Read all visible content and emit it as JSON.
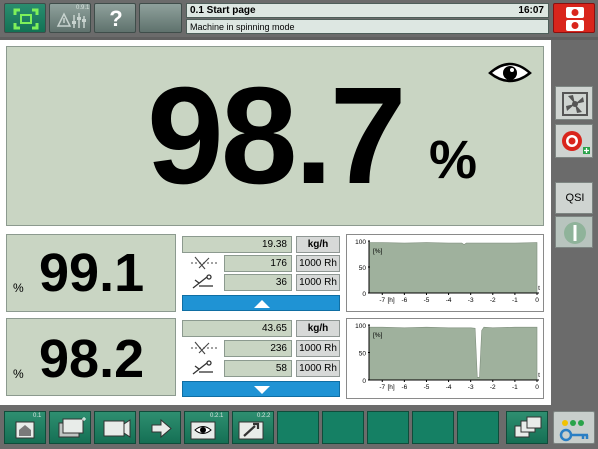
{
  "header": {
    "page_title": "0.1 Start page",
    "time": "16:07",
    "status_message": "Machine in spinning mode",
    "button_badges": {
      "signal": "0.9.1"
    }
  },
  "main": {
    "big_value": "98.7",
    "big_unit": "%"
  },
  "side": {
    "qsi_label": "QSI"
  },
  "rows": [
    {
      "percent_value": "99.1",
      "percent_unit": "%",
      "rate_value": "19.38",
      "rate_unit": "kg/h",
      "cut_count": "176",
      "cut_unit": "1000 Rh",
      "splice_count": "36",
      "splice_unit": "1000 Rh",
      "arrow": "up"
    },
    {
      "percent_value": "98.2",
      "percent_unit": "%",
      "rate_value": "43.65",
      "rate_unit": "kg/h",
      "cut_count": "236",
      "cut_unit": "1000 Rh",
      "splice_count": "58",
      "splice_unit": "1000 Rh",
      "arrow": "down"
    }
  ],
  "chart_data": [
    {
      "type": "area",
      "ylabel": "[%]",
      "xlabel": "[h]",
      "x_axis_letter": "t",
      "y_ticks": [
        "100",
        "50",
        "0"
      ],
      "x_ticks": [
        "-7",
        "-6",
        "-5",
        "-4",
        "-3",
        "-2",
        "-1",
        "0"
      ],
      "ylim": [
        0,
        100
      ],
      "xlim": [
        -7.6,
        0
      ],
      "x": [
        -7.6,
        -7,
        -6,
        -5,
        -4,
        -3.4,
        -3.3,
        -3.2,
        -3,
        -2.5,
        -2,
        -1,
        0
      ],
      "values": [
        97,
        97,
        96,
        97,
        96,
        96,
        93,
        96,
        96,
        96,
        96,
        96,
        97
      ]
    },
    {
      "type": "area",
      "ylabel": "[%]",
      "xlabel": "[h]",
      "x_axis_letter": "t",
      "y_ticks": [
        "100",
        "50",
        "0"
      ],
      "x_ticks": [
        "-7",
        "-6",
        "-5",
        "-4",
        "-3",
        "-2",
        "-1",
        "0"
      ],
      "ylim": [
        0,
        100
      ],
      "xlim": [
        -7.6,
        0
      ],
      "x": [
        -7.6,
        -7,
        -6,
        -5,
        -4,
        -3,
        -2.8,
        -2.7,
        -2.6,
        -2.5,
        -2.4,
        -2,
        -1,
        0
      ],
      "values": [
        96,
        96,
        95,
        96,
        95,
        95,
        94,
        5,
        5,
        90,
        96,
        95,
        96,
        96
      ]
    }
  ],
  "bottom_bar": {
    "badges": {
      "home": "0.1",
      "monitor": "0.2.1",
      "settings": "0.2.2"
    }
  },
  "colors": {
    "panel_bg": "#c9d5c3",
    "accent_blue": "#1f93d4",
    "stop_red": "#d9251c",
    "chart_fill": "#9fb19d"
  }
}
